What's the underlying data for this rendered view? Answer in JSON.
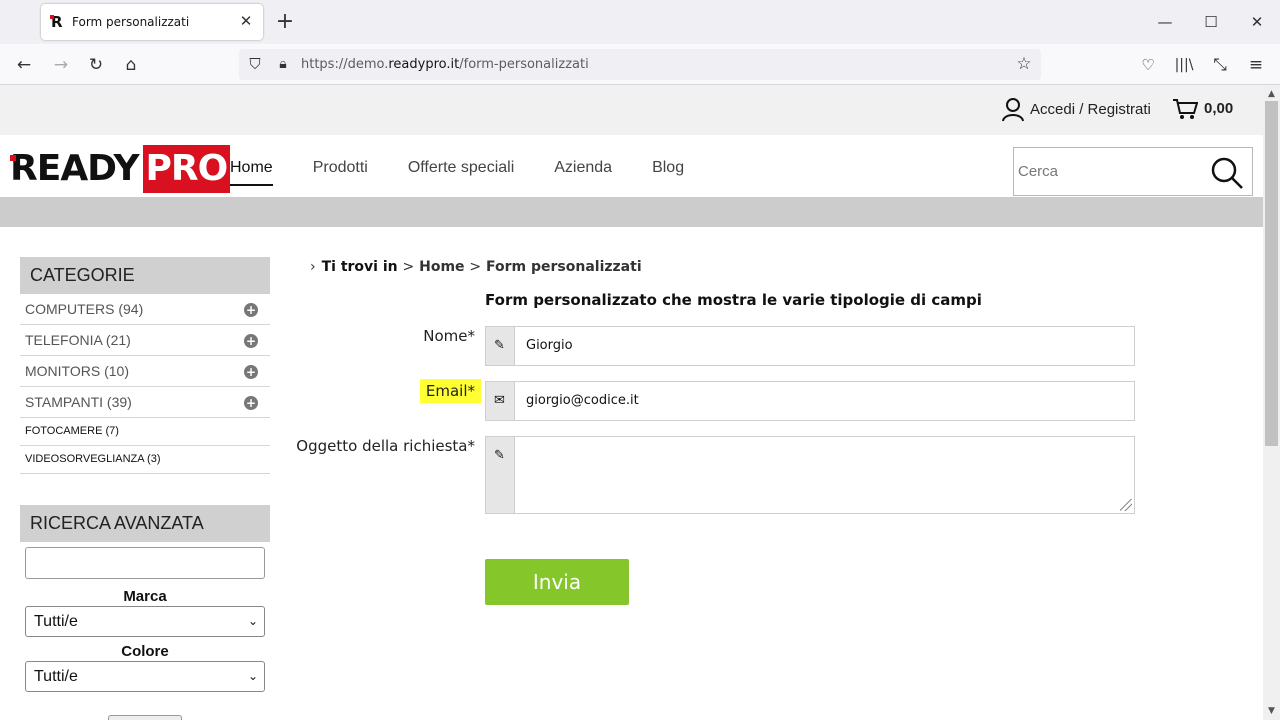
{
  "browser": {
    "tab_title": "Form personalizzati",
    "url_prefix": "https://demo.",
    "url_host": "readypro.it",
    "url_path": "/form-personalizzati"
  },
  "topbar": {
    "account_label": "Accedi / Registrati",
    "cart_total": "0,00"
  },
  "logo": {
    "part1": "READY",
    "part2": "PRO"
  },
  "menu": [
    {
      "label": "Home",
      "active": true
    },
    {
      "label": "Prodotti"
    },
    {
      "label": "Offerte speciali"
    },
    {
      "label": "Azienda"
    },
    {
      "label": "Blog"
    }
  ],
  "search": {
    "placeholder": "Cerca"
  },
  "sidebar": {
    "categories_title": "CATEGORIE",
    "categories": [
      {
        "label": "COMPUTERS (94)",
        "expandable": true
      },
      {
        "label": "TELEFONIA (21)",
        "expandable": true
      },
      {
        "label": "MONITORS (10)",
        "expandable": true
      },
      {
        "label": "STAMPANTI (39)",
        "expandable": true
      },
      {
        "label": "FOTOCAMERE (7)",
        "expandable": false
      },
      {
        "label": "VIDEOSORVEGLIANZA (3)",
        "expandable": false
      }
    ],
    "advanced_title": "RICERCA AVANZATA",
    "brand_label": "Marca",
    "brand_value": "Tutti/e",
    "color_label": "Colore",
    "color_value": "Tutti/e"
  },
  "breadcrumb": {
    "lead": "Ti trovi in",
    "sep": ">",
    "home": "Home",
    "current": "Form personalizzati"
  },
  "form": {
    "title": "Form personalizzato che mostra le varie tipologie di campi",
    "name_label": "Nome*",
    "name_value": "Giorgio",
    "email_label": "Email*",
    "email_value": "giorgio@codice.it",
    "subject_label": "Oggetto della richiesta*",
    "subject_value": "",
    "submit_label": "Invia"
  },
  "colors": {
    "brand_red": "#d8101f",
    "submit_green": "#85c72b",
    "highlight_yellow": "#ffff33"
  }
}
